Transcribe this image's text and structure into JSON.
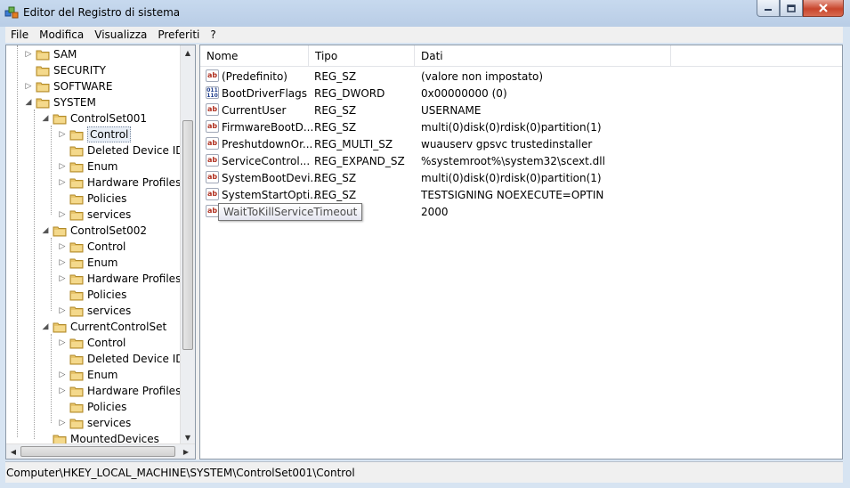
{
  "window": {
    "title": "Editor del Registro di sistema",
    "icons": {
      "app": "registry-editor-icon",
      "minimize": "minimize-icon",
      "maximize": "maximize-icon",
      "close": "close-icon"
    },
    "close_color": "#c8452c"
  },
  "menubar": {
    "items": [
      "File",
      "Modifica",
      "Visualizza",
      "Preferiti",
      "?"
    ]
  },
  "tree": {
    "items": [
      {
        "label": "SAM",
        "expander": "▷"
      },
      {
        "label": "SECURITY",
        "expander": ""
      },
      {
        "label": "SOFTWARE",
        "expander": "▷"
      },
      {
        "label": "SYSTEM",
        "expander": "◢"
      },
      {
        "label": "ControlSet001",
        "expander": "◢"
      },
      {
        "label": "Control",
        "expander": "▷",
        "selected": true
      },
      {
        "label": "Deleted Device IDs",
        "expander": ""
      },
      {
        "label": "Enum",
        "expander": "▷"
      },
      {
        "label": "Hardware Profiles",
        "expander": "▷"
      },
      {
        "label": "Policies",
        "expander": ""
      },
      {
        "label": "services",
        "expander": "▷"
      },
      {
        "label": "ControlSet002",
        "expander": "◢"
      },
      {
        "label": "Control",
        "expander": "▷"
      },
      {
        "label": "Enum",
        "expander": "▷"
      },
      {
        "label": "Hardware Profiles",
        "expander": "▷"
      },
      {
        "label": "Policies",
        "expander": ""
      },
      {
        "label": "services",
        "expander": "▷"
      },
      {
        "label": "CurrentControlSet",
        "expander": "◢"
      },
      {
        "label": "Control",
        "expander": "▷"
      },
      {
        "label": "Deleted Device IDs",
        "expander": ""
      },
      {
        "label": "Enum",
        "expander": "▷"
      },
      {
        "label": "Hardware Profiles",
        "expander": "▷"
      },
      {
        "label": "Policies",
        "expander": ""
      },
      {
        "label": "services",
        "expander": "▷"
      },
      {
        "label": "MountedDevices",
        "expander": ""
      }
    ]
  },
  "list": {
    "columns": [
      "Nome",
      "Tipo",
      "Dati"
    ],
    "rows": [
      {
        "name": "(Predefinito)",
        "type": "REG_SZ",
        "data": "(valore non impostato)",
        "icon": "ab"
      },
      {
        "name": "BootDriverFlags",
        "type": "REG_DWORD",
        "data": "0x00000000 (0)",
        "icon": "bin"
      },
      {
        "name": "CurrentUser",
        "type": "REG_SZ",
        "data": "USERNAME",
        "icon": "ab"
      },
      {
        "name": "FirmwareBootD...",
        "type": "REG_SZ",
        "data": "multi(0)disk(0)rdisk(0)partition(1)",
        "icon": "ab"
      },
      {
        "name": "PreshutdownOr...",
        "type": "REG_MULTI_SZ",
        "data": "wuauserv gpsvc trustedinstaller",
        "icon": "ab"
      },
      {
        "name": "ServiceControl...",
        "type": "REG_EXPAND_SZ",
        "data": "%systemroot%\\system32\\scext.dll",
        "icon": "ab"
      },
      {
        "name": "SystemBootDevi...",
        "type": "REG_SZ",
        "data": "multi(0)disk(0)rdisk(0)partition(1)",
        "icon": "ab"
      },
      {
        "name": "SystemStartOpti...",
        "type": "REG_SZ",
        "data": " TESTSIGNING  NOEXECUTE=OPTIN",
        "icon": "ab"
      },
      {
        "name": "",
        "type": "",
        "data": "2000",
        "icon": "ab"
      }
    ],
    "tooltip": "WaitToKillServiceTimeout"
  },
  "statusbar": {
    "path": "Computer\\HKEY_LOCAL_MACHINE\\SYSTEM\\ControlSet001\\Control"
  }
}
